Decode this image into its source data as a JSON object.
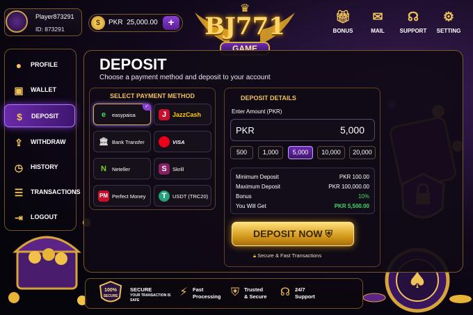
{
  "user": {
    "name": "Player873291",
    "id_label": "ID: 873291"
  },
  "balance": {
    "currency": "PKR",
    "amount": "25,000.00",
    "coin": "$",
    "add": "+"
  },
  "logo": {
    "name": "BJ771",
    "tag": "GAME"
  },
  "nav": [
    {
      "label": "BONUS",
      "icon": "gift-icon"
    },
    {
      "label": "MAIL",
      "icon": "mail-icon"
    },
    {
      "label": "SUPPORT",
      "icon": "headset-icon"
    },
    {
      "label": "SETTING",
      "icon": "gear-icon"
    }
  ],
  "sidebar": [
    {
      "label": "PROFILE",
      "icon": "user-icon"
    },
    {
      "label": "WALLET",
      "icon": "wallet-icon"
    },
    {
      "label": "DEPOSIT",
      "icon": "dollar-icon",
      "active": true
    },
    {
      "label": "WITHDRAW",
      "icon": "withdraw-icon"
    },
    {
      "label": "HISTORY",
      "icon": "clock-icon"
    },
    {
      "label": "TRANSACTIONS",
      "icon": "list-icon"
    },
    {
      "label": "LOGOUT",
      "icon": "logout-icon"
    }
  ],
  "page": {
    "title": "DEPOSIT",
    "subtitle": "Choose a payment method and deposit to your account"
  },
  "payment": {
    "heading": "SELECT PAYMENT METHOD",
    "methods": [
      {
        "label": "easypaisa",
        "icon": "e",
        "selected": true
      },
      {
        "label": "JazzCash",
        "icon": "J"
      },
      {
        "label": "Bank Transfer",
        "icon": "bank-icon"
      },
      {
        "label": "VISA",
        "icon": "card-icon"
      },
      {
        "label": "Neteller",
        "icon": "N"
      },
      {
        "label": "Skrill",
        "icon": "S"
      },
      {
        "label": "Perfect Money",
        "icon": "PM"
      },
      {
        "label": "USDT (TRC20)",
        "icon": "T"
      }
    ]
  },
  "details": {
    "heading": "DEPOSIT DETAILS",
    "amount_label": "Enter Amount (PKR)",
    "currency": "PKR",
    "amount": "5,000",
    "chips": [
      "500",
      "1,000",
      "5,000",
      "10,000",
      "20,000"
    ],
    "selected_chip": "5,000",
    "rows": [
      {
        "k": "Minimum Deposit",
        "v": "PKR 100.00"
      },
      {
        "k": "Maximum Deposit",
        "v": "PKR 100,000.00"
      },
      {
        "k": "Bonus",
        "v": "10%"
      },
      {
        "k": "You Will Get",
        "v": "PKR 5,500.00"
      }
    ],
    "button": "DEPOSIT NOW",
    "secure_note": "Secure & Fast Transactions"
  },
  "features": [
    {
      "line1": "100%",
      "line2": "SECURE"
    },
    {
      "line1": "SECURE",
      "line2": "YOUR TRANSACTION IS SAFE"
    },
    {
      "line1": "Fast",
      "line2": "Processing"
    },
    {
      "line1": "Trusted",
      "line2": "& Secure"
    },
    {
      "line1": "24/7",
      "line2": "Support"
    }
  ],
  "colors": {
    "gold": "#f0c25a",
    "purple": "#6c2bb3",
    "green": "#3ddc64"
  }
}
